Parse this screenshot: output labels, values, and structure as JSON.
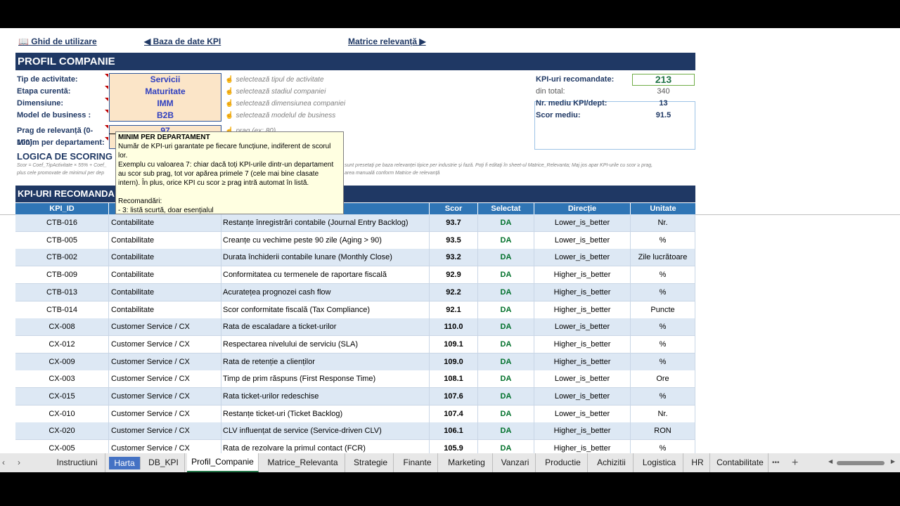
{
  "nav": {
    "guide": "📖 Ghid de utilizare",
    "db": "◀ Baza de date KPI",
    "matrix": "Matrice relevanță ▶"
  },
  "profile": {
    "banner": "PROFIL COMPANIE",
    "fields": [
      {
        "label": "Tip de activitate:",
        "value": "Servicii",
        "hint": "selectează tipul de activitate"
      },
      {
        "label": "Etapa curentă:",
        "value": "Maturitate",
        "hint": "selectează stadiul companiei"
      },
      {
        "label": "Dimensiune:",
        "value": "IMM",
        "hint": "selectează dimensiunea companiei"
      },
      {
        "label": "Model de business :",
        "value": "B2B",
        "hint": "selectează modelul de business"
      }
    ],
    "threshold_label": "Prag de relevanță (0-100):",
    "threshold_value": "97",
    "threshold_hint": "prag (ex: 80)",
    "min_label": "Minim per departament:",
    "hint_icon": "☝"
  },
  "summary": {
    "recommended_label": "KPI-uri recomandate:",
    "recommended_value": "213",
    "total_label": "din total:",
    "total_value": "340",
    "avg_kpi_label": "Nr. mediu KPI/dept:",
    "avg_kpi_value": "13",
    "avg_score_label": "Scor mediu:",
    "avg_score_value": "91.5"
  },
  "scoring": {
    "title": "LOGICA DE SCORING (",
    "note1": "Scor = Coef_TipActivitate × 55% + Coef_",
    "note2": "plus cele promovate de minimul per dep",
    "note3": "sunt presetați pe baza relevanței tipice per industrie și fază. Poţi fi editaţi în sheet-ul Matrice_Relevanta; Maj jos apar KPI-urile cu scor ≥ prag,",
    "note4": "area manuală conform Matrice de relevanță"
  },
  "table": {
    "banner": "KPI-URI RECOMANDA",
    "headers": [
      "KPI_ID",
      "",
      "",
      "Scor",
      "Selectat",
      "Direcție",
      "Unitate"
    ],
    "rows": [
      {
        "id": "CTB-016",
        "dep": "Contabilitate",
        "name": "Restanțe înregistrări contabile (Journal Entry Backlog)",
        "score": "93.7",
        "sel": "DA",
        "dir": "Lower_is_better",
        "unit": "Nr."
      },
      {
        "id": "CTB-005",
        "dep": "Contabilitate",
        "name": "Creanțe cu vechime peste 90 zile (Aging > 90)",
        "score": "93.5",
        "sel": "DA",
        "dir": "Lower_is_better",
        "unit": "%"
      },
      {
        "id": "CTB-002",
        "dep": "Contabilitate",
        "name": "Durata închiderii contabile lunare (Monthly Close)",
        "score": "93.2",
        "sel": "DA",
        "dir": "Lower_is_better",
        "unit": "Zile lucrătoare"
      },
      {
        "id": "CTB-009",
        "dep": "Contabilitate",
        "name": "Conformitatea cu termenele de raportare fiscală",
        "score": "92.9",
        "sel": "DA",
        "dir": "Higher_is_better",
        "unit": "%"
      },
      {
        "id": "CTB-013",
        "dep": "Contabilitate",
        "name": "Acuratețea prognozei cash flow",
        "score": "92.2",
        "sel": "DA",
        "dir": "Higher_is_better",
        "unit": "%"
      },
      {
        "id": "CTB-014",
        "dep": "Contabilitate",
        "name": "Scor conformitate fiscală (Tax Compliance)",
        "score": "92.1",
        "sel": "DA",
        "dir": "Higher_is_better",
        "unit": "Puncte"
      },
      {
        "id": "CX-008",
        "dep": "Customer Service / CX",
        "name": "Rata de escaladare a ticket-urilor",
        "score": "110.0",
        "sel": "DA",
        "dir": "Lower_is_better",
        "unit": "%"
      },
      {
        "id": "CX-012",
        "dep": "Customer Service / CX",
        "name": "Respectarea nivelului de serviciu (SLA)",
        "score": "109.1",
        "sel": "DA",
        "dir": "Higher_is_better",
        "unit": "%"
      },
      {
        "id": "CX-009",
        "dep": "Customer Service / CX",
        "name": "Rata de retenție a clienților",
        "score": "109.0",
        "sel": "DA",
        "dir": "Higher_is_better",
        "unit": "%"
      },
      {
        "id": "CX-003",
        "dep": "Customer Service / CX",
        "name": "Timp de prim răspuns (First Response Time)",
        "score": "108.1",
        "sel": "DA",
        "dir": "Lower_is_better",
        "unit": "Ore"
      },
      {
        "id": "CX-015",
        "dep": "Customer Service / CX",
        "name": "Rata ticket-urilor redeschise",
        "score": "107.6",
        "sel": "DA",
        "dir": "Lower_is_better",
        "unit": "%"
      },
      {
        "id": "CX-010",
        "dep": "Customer Service / CX",
        "name": "Restanțe ticket-uri (Ticket Backlog)",
        "score": "107.4",
        "sel": "DA",
        "dir": "Lower_is_better",
        "unit": "Nr."
      },
      {
        "id": "CX-020",
        "dep": "Customer Service / CX",
        "name": "CLV influențat de service (Service-driven CLV)",
        "score": "106.1",
        "sel": "DA",
        "dir": "Higher_is_better",
        "unit": "RON"
      },
      {
        "id": "CX-005",
        "dep": "Customer Service / CX",
        "name": "Rata de rezolvare la primul contact (FCR)",
        "score": "105.9",
        "sel": "DA",
        "dir": "Higher_is_better",
        "unit": "%"
      }
    ]
  },
  "tooltip": {
    "title": "MINIM PER DEPARTAMENT",
    "line1": "Număr de KPI-uri garantate pe fiecare funcțiune, indiferent de scorul lor.",
    "line2": "Exemplu cu valoarea 7: chiar dacă toți KPI-urile dintr-un departament au scor sub prag, tot vor apărea primele 7 (cele mai bine clasate intern). În plus, orice KPI cu scor ≥ prag intră automat în listă.",
    "line3": "Recomandări:",
    "line4": "- 3: listă scurtă, doar esențialul"
  },
  "tabs": {
    "prev": "‹",
    "next": "›",
    "items": [
      "Instructiuni",
      "Harta",
      "DB_KPI",
      "Profil_Companie",
      "Matrice_Relevanta",
      "Strategie",
      "Finante",
      "Marketing",
      "Vanzari",
      "Productie",
      "Achizitii",
      "Logistica",
      "HR",
      "Contabilitate"
    ],
    "active": "Profil_Companie",
    "more": "•••",
    "add": "+"
  }
}
